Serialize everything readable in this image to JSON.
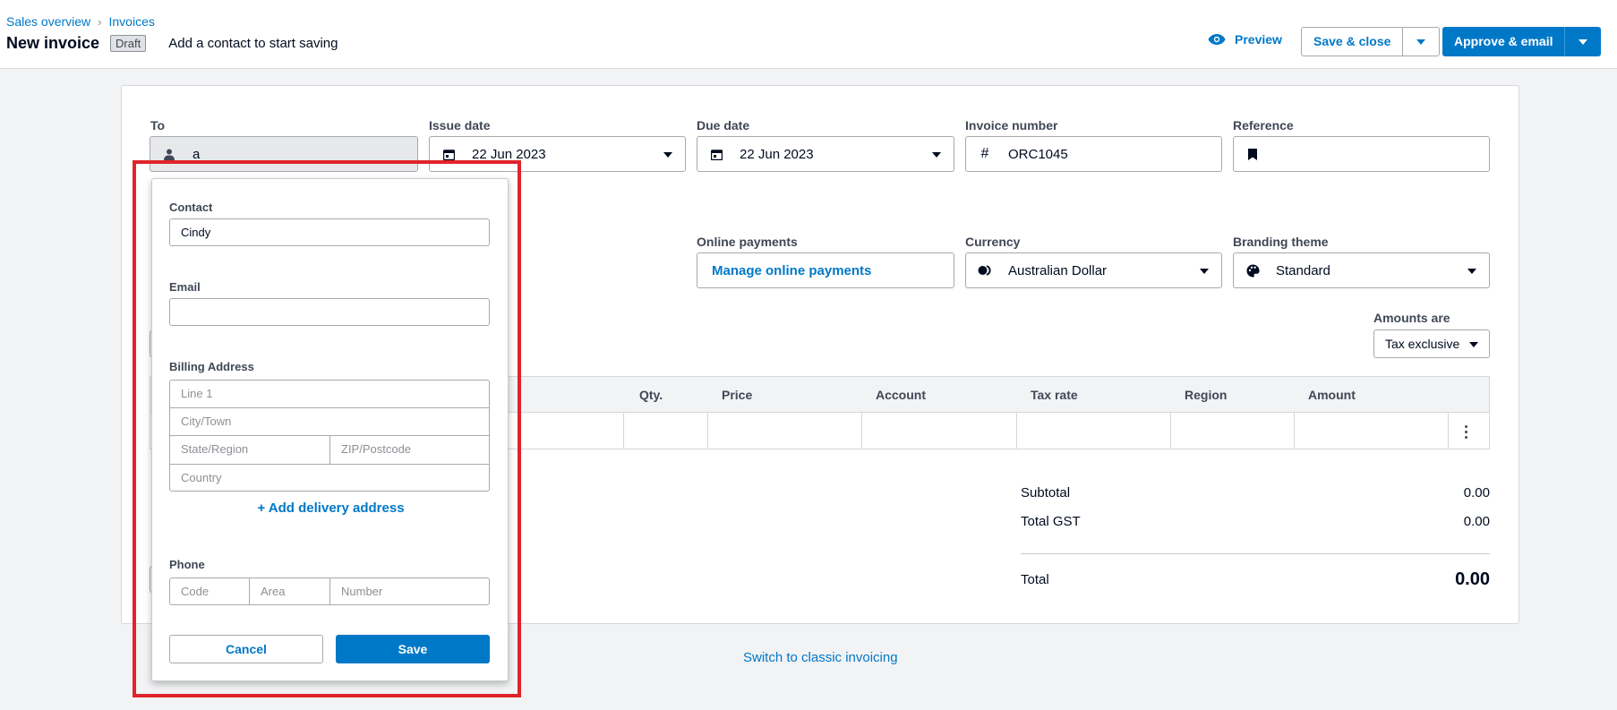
{
  "header": {
    "breadcrumbs": [
      "Sales overview",
      "Invoices"
    ],
    "title": "New invoice",
    "status_badge": "Draft",
    "hint": "Add a contact to start saving",
    "preview_label": "Preview",
    "save_close_label": "Save & close",
    "approve_label": "Approve & email"
  },
  "form": {
    "to_label": "To",
    "to_value": "a",
    "issue_date_label": "Issue date",
    "issue_date_value": "22 Jun 2023",
    "due_date_label": "Due date",
    "due_date_value": "22 Jun 2023",
    "invoice_number_label": "Invoice number",
    "invoice_number_value": "ORC1045",
    "reference_label": "Reference",
    "reference_value": "",
    "online_payments_label": "Online payments",
    "manage_payments_label": "Manage online payments",
    "currency_label": "Currency",
    "currency_value": "Australian Dollar",
    "branding_label": "Branding theme",
    "branding_value": "Standard",
    "amounts_are_label": "Amounts are",
    "amounts_are_value": "Tax exclusive"
  },
  "table": {
    "columns": [
      "Qty.",
      "Price",
      "Account",
      "Tax rate",
      "Region",
      "Amount"
    ]
  },
  "totals": {
    "subtotal_label": "Subtotal",
    "subtotal_value": "0.00",
    "gst_label": "Total GST",
    "gst_value": "0.00",
    "total_label": "Total",
    "total_value": "0.00"
  },
  "switch_link": "Switch to classic invoicing",
  "contact_popup": {
    "contact_label": "Contact",
    "contact_value": "Cindy",
    "email_label": "Email",
    "email_value": "",
    "billing_label": "Billing Address",
    "line1_placeholder": "Line 1",
    "city_placeholder": "City/Town",
    "state_placeholder": "State/Region",
    "zip_placeholder": "ZIP/Postcode",
    "country_placeholder": "Country",
    "add_delivery_label": "+ Add delivery address",
    "phone_label": "Phone",
    "code_placeholder": "Code",
    "area_placeholder": "Area",
    "number_placeholder": "Number",
    "cancel_label": "Cancel",
    "save_label": "Save"
  },
  "colors": {
    "accent": "#0078c8",
    "highlight": "#e0242b"
  }
}
